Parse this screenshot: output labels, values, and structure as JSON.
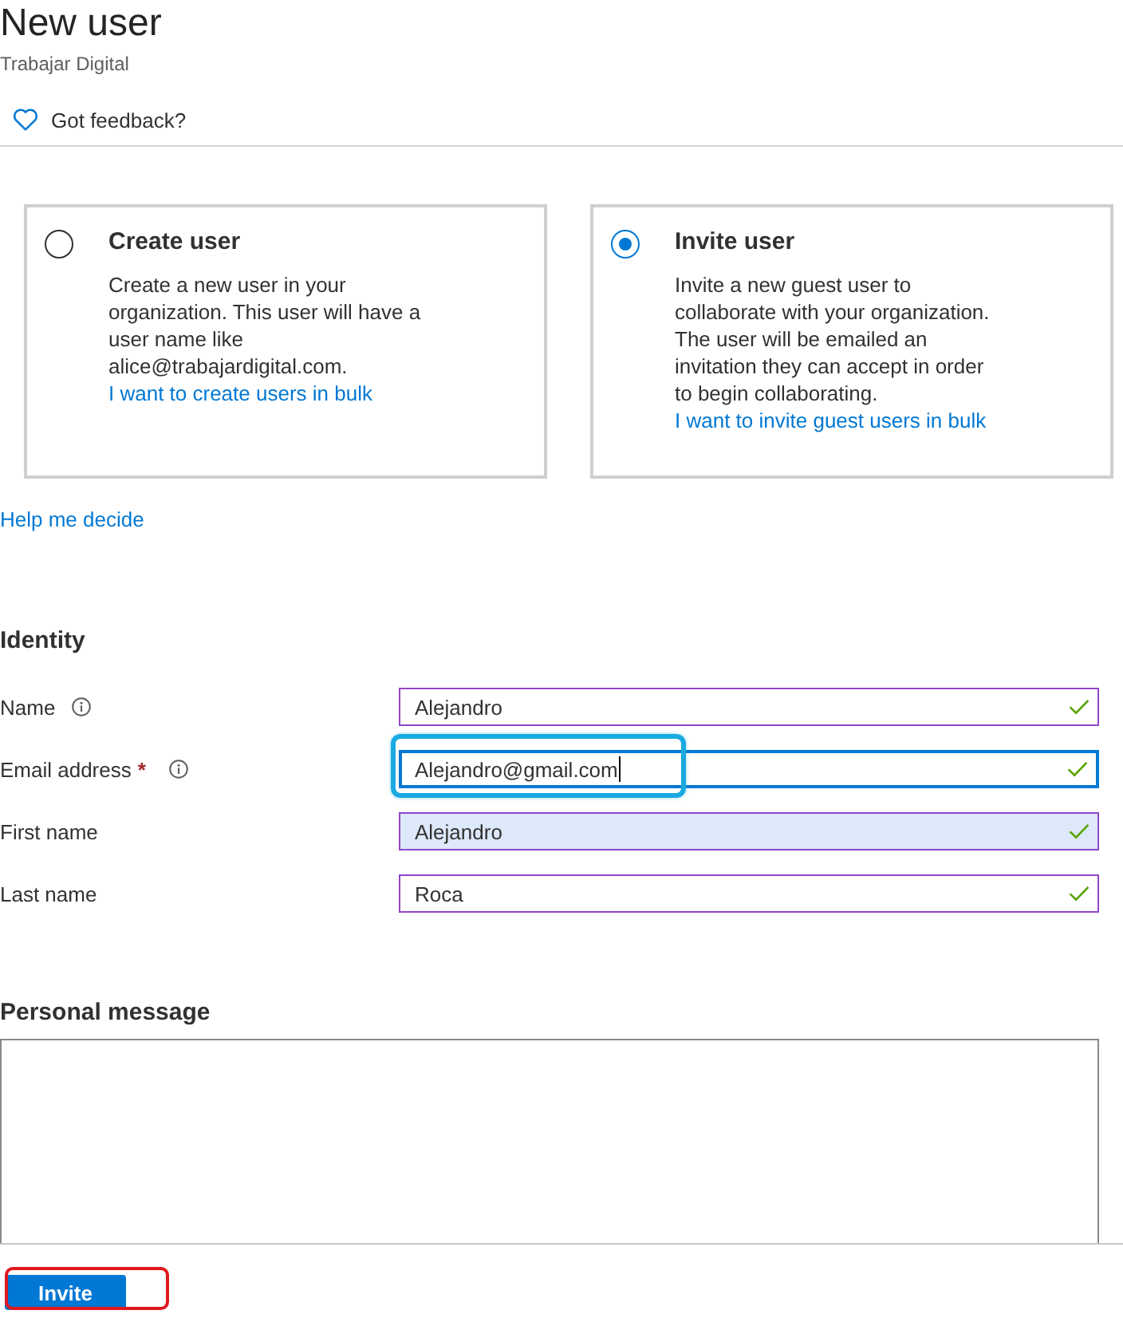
{
  "header": {
    "title": "New user",
    "subtitle": "Trabajar Digital"
  },
  "feedback": {
    "label": "Got feedback?"
  },
  "options": [
    {
      "title": "Create user",
      "description": "Create a new user in your organization. This user will have a user name like alice@trabajardigital.com.",
      "link": "I want to create users in bulk",
      "selected": false
    },
    {
      "title": "Invite user",
      "description": "Invite a new guest user to collaborate with your organization. The user will be emailed an invitation they can accept in order to begin collaborating.",
      "link": "I want to invite guest users in bulk",
      "selected": true
    }
  ],
  "help_link": "Help me decide",
  "identity": {
    "heading": "Identity",
    "fields": [
      {
        "label": "Name",
        "info": true,
        "value": "Alejandro",
        "valid": true,
        "focused": false,
        "autofilled": false,
        "highlighted": false
      },
      {
        "label": "Email address",
        "required_mark": "*",
        "info": true,
        "value": "Alejandro@gmail.com",
        "valid": true,
        "focused": true,
        "autofilled": false,
        "highlighted": true
      },
      {
        "label": "First name",
        "info": false,
        "value": "Alejandro",
        "valid": true,
        "focused": false,
        "autofilled": true,
        "highlighted": false
      },
      {
        "label": "Last name",
        "info": false,
        "value": "Roca",
        "valid": true,
        "focused": false,
        "autofilled": false,
        "highlighted": false
      }
    ]
  },
  "message": {
    "heading": "Personal message"
  },
  "footer": {
    "button": "Invite",
    "highlighted": true
  }
}
